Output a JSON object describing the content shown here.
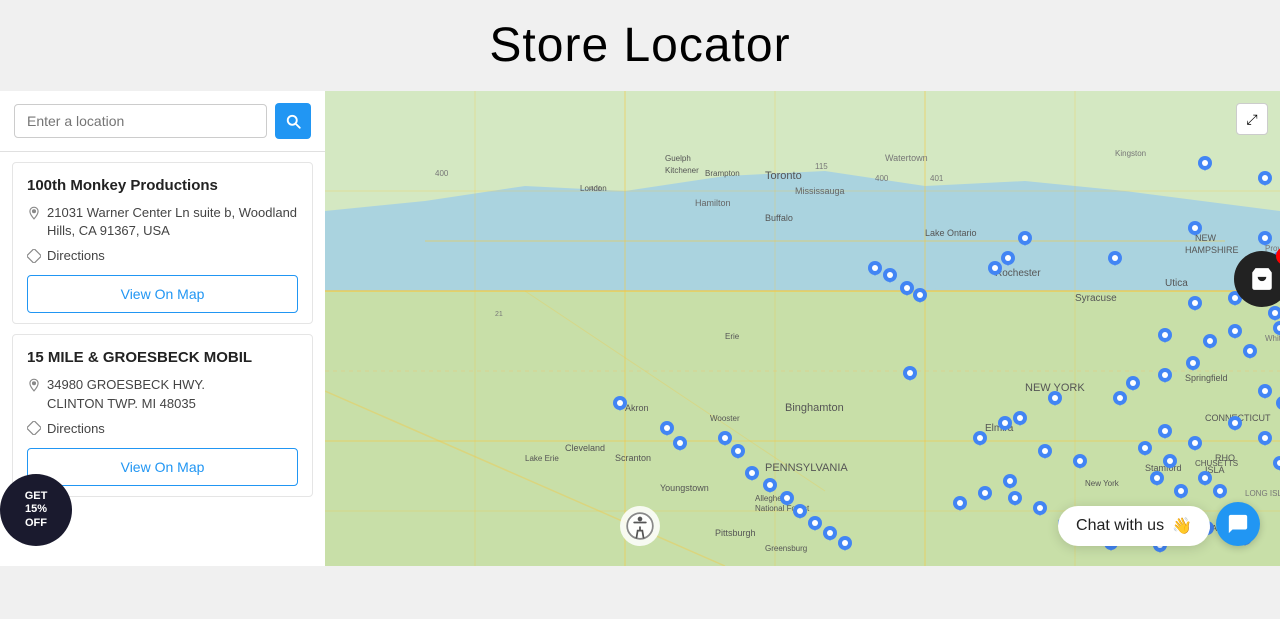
{
  "page": {
    "title": "Store Locator"
  },
  "search": {
    "placeholder": "Enter a location"
  },
  "stores": [
    {
      "id": "store-1",
      "name": "100th Monkey Productions",
      "address": "21031 Warner Center Ln suite b, Woodland Hills, CA 91367, USA",
      "directions_label": "Directions",
      "view_map_label": "View On Map"
    },
    {
      "id": "store-2",
      "name": "15 MILE & GROESBECK MOBIL",
      "address": "34980 GROESBECK HWY.\nCLINTON TWP. MI 48035",
      "directions_label": "Directions",
      "view_map_label": "View On Map"
    }
  ],
  "chat": {
    "label": "Chat with us",
    "emoji": "👋"
  },
  "discount": {
    "line1": "GET",
    "line2": "15%",
    "line3": "OFF"
  },
  "map": {
    "expand_icon": "⤢"
  }
}
